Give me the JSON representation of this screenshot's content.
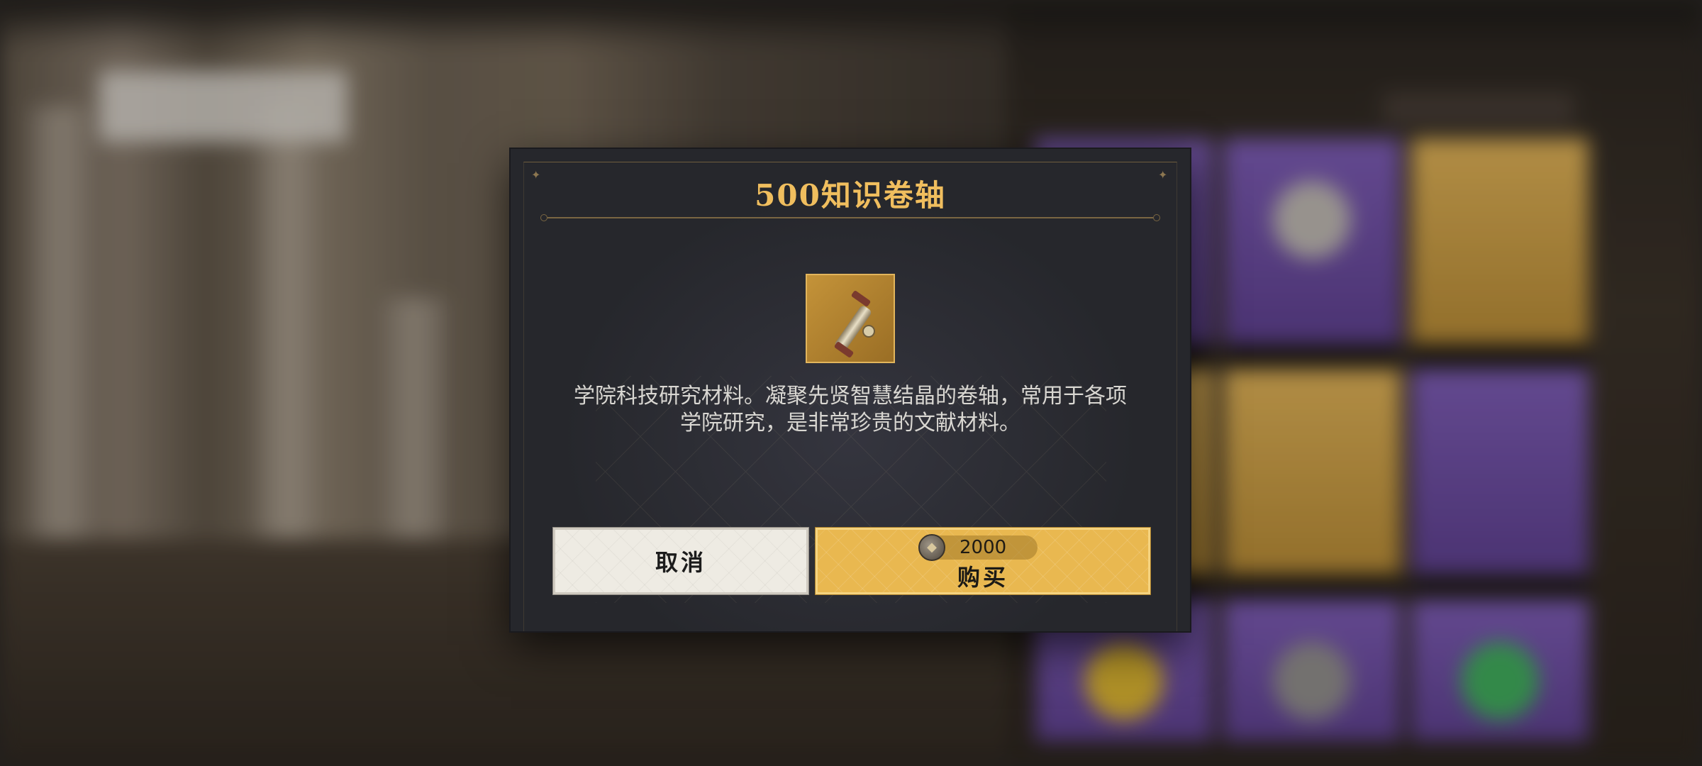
{
  "dialog": {
    "title": "500知识卷轴",
    "item_icon": "scroll-icon",
    "description_line1": "学院科技研究材料。凝聚先贤智慧结晶的卷轴，常用于各项",
    "description_line2": "学院研究，是非常珍贵的文献材料。",
    "cancel_label": "取消",
    "buy_label": "购买",
    "price": "2000",
    "currency_icon": "coin-icon"
  },
  "colors": {
    "title": "#f0be5e",
    "buy_button": "#e9b850",
    "cancel_button": "#eeebe3",
    "dialog_bg": "#26272c"
  }
}
